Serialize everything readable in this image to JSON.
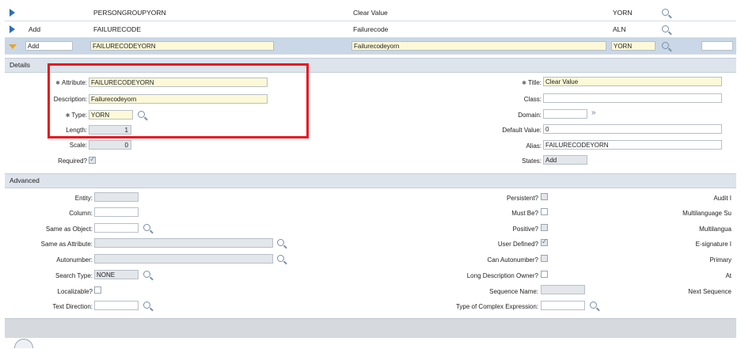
{
  "grid": {
    "rows": [
      {
        "action": "",
        "attribute": "PERSONGROUPYORN",
        "title": "Clear Value",
        "type": "YORN"
      },
      {
        "action": "Add",
        "attribute": "FAILURECODE",
        "title": "Failurecode",
        "type": "ALN"
      },
      {
        "action": "Add",
        "attribute": "FAILURECODEYORN",
        "title": "Failurecodeyorn",
        "type": "YORN"
      }
    ]
  },
  "details": {
    "section_label": "Details",
    "attribute_label": "Attribute:",
    "attribute_value": "FAILURECODEYORN",
    "description_label": "Description:",
    "description_value": "Failurecodeyorn",
    "type_label": "Type:",
    "type_value": "YORN",
    "length_label": "Length:",
    "length_value": "1",
    "scale_label": "Scale:",
    "scale_value": "0",
    "required_label": "Required?",
    "title_label": "Title:",
    "title_value": "Clear Value",
    "class_label": "Class:",
    "class_value": "",
    "domain_label": "Domain:",
    "domain_value": "",
    "default_label": "Default Value:",
    "default_value": "0",
    "alias_label": "Alias:",
    "alias_value": "FAILURECODEYORN",
    "states_label": "States:",
    "states_value": "Add"
  },
  "advanced": {
    "section_label": "Advanced",
    "entity_label": "Entity:",
    "column_label": "Column:",
    "same_object_label": "Same as Object:",
    "same_attribute_label": "Same as Attribute:",
    "autonumber_label": "Autonumber:",
    "search_type_label": "Search Type:",
    "search_type_value": "NONE",
    "localizable_label": "Localizable?",
    "text_direction_label": "Text Direction:",
    "persistent_label": "Persistent?",
    "must_be_label": "Must Be?",
    "positive_label": "Positive?",
    "user_defined_label": "User Defined?",
    "can_autonumber_label": "Can Autonumber?",
    "long_desc_label": "Long Description Owner?",
    "sequence_name_label": "Sequence Name:",
    "complex_expr_label": "Type of Complex Expression:",
    "audit_label": "Audit I",
    "multilang_sup_label": "Multilanguage Su",
    "multilang_label": "Multilangua",
    "esig_label": "E-signature I",
    "primary_label": "Primary",
    "at_label": "At",
    "next_seq_label": "Next Sequence"
  }
}
